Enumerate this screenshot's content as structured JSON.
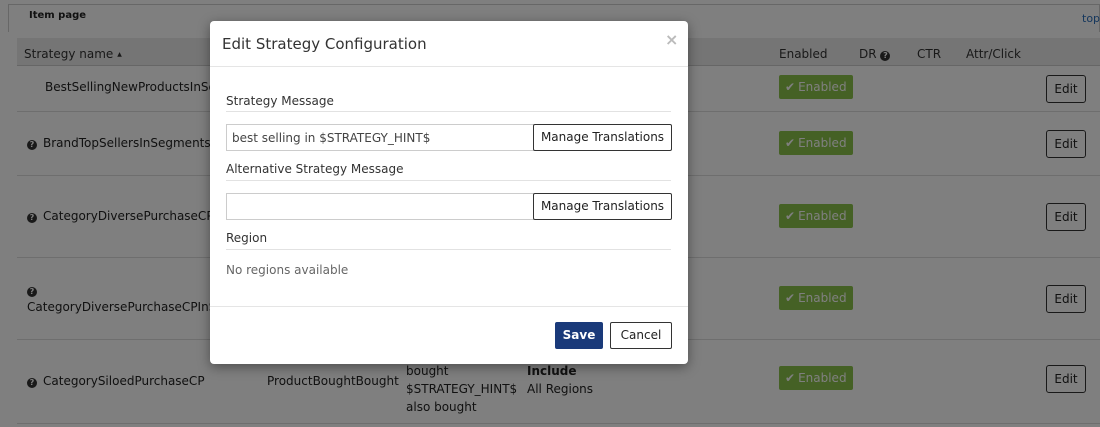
{
  "page": {
    "section_title": "Item page",
    "top_link": "top"
  },
  "table": {
    "headers": {
      "strategy_name": "Strategy name",
      "enabled": "Enabled",
      "dr": "DR",
      "ctr": "CTR",
      "attr_click": "Attr/Click"
    },
    "rows": [
      {
        "name": "BestSellingNewProductsInSeg",
        "status": "Enabled",
        "action": "Edit"
      },
      {
        "name": "BrandTopSellersInSegments",
        "status": "Enabled",
        "action": "Edit"
      },
      {
        "name": "CategoryDiversePurchaseCP",
        "status": "Enabled",
        "action": "Edit"
      },
      {
        "name": "CategoryDiversePurchaseCPInSe",
        "status": "Enabled",
        "action": "Edit"
      },
      {
        "name": "CategorySiloedPurchaseCP",
        "type": "ProductBoughtBought",
        "message_lines": [
          "bought",
          "$STRATEGY_HINT$",
          "also bought"
        ],
        "region_rule": "Include",
        "region_value": "All Regions",
        "status": "Enabled",
        "action": "Edit"
      }
    ]
  },
  "modal": {
    "title": "Edit Strategy Configuration",
    "close_symbol": "×",
    "strategy_message": {
      "label": "Strategy Message",
      "value": "best selling in $STRATEGY_HINT$",
      "translations_button": "Manage Translations"
    },
    "alternative_message": {
      "label": "Alternative Strategy Message",
      "value": "",
      "translations_button": "Manage Translations"
    },
    "region": {
      "label": "Region",
      "empty_text": "No regions available"
    },
    "save_label": "Save",
    "cancel_label": "Cancel"
  },
  "colors": {
    "enabled_badge": "#8bc34a",
    "save_button": "#1a3a7a",
    "overlay": "rgba(0,0,0,0.5)"
  }
}
